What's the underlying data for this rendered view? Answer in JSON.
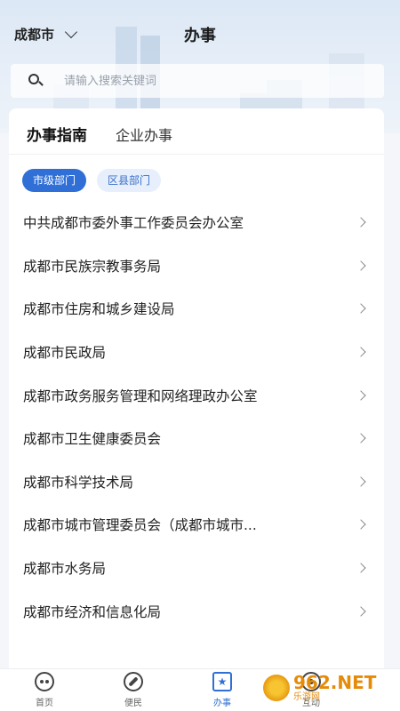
{
  "header": {
    "city": "成都市",
    "title": "办事"
  },
  "search": {
    "placeholder": "请输入搜索关键词"
  },
  "tabs": [
    {
      "label": "办事指南",
      "active": true
    },
    {
      "label": "企业办事",
      "active": false
    }
  ],
  "chips": [
    {
      "label": "市级部门",
      "active": true
    },
    {
      "label": "区县部门",
      "active": false
    }
  ],
  "departments": [
    "中共成都市委外事工作委员会办公室",
    "成都市民族宗教事务局",
    "成都市住房和城乡建设局",
    "成都市民政局",
    "成都市政务服务管理和网络理政办公室",
    "成都市卫生健康委员会",
    "成都市科学技术局",
    "成都市城市管理委员会（成都市城市...",
    "成都市水务局",
    "成都市经济和信息化局"
  ],
  "tabbar": [
    {
      "label": "首页",
      "icon": "panda-icon",
      "active": false
    },
    {
      "label": "便民",
      "icon": "compass-icon",
      "active": false
    },
    {
      "label": "办事",
      "icon": "star-icon",
      "active": true
    },
    {
      "label": "互动",
      "icon": "radio-icon",
      "active": false
    }
  ],
  "watermark": {
    "main": "962.NET",
    "sub": "乐游网"
  },
  "colors": {
    "accent": "#2f6fd6",
    "chip_inactive_bg": "#e6effb"
  }
}
